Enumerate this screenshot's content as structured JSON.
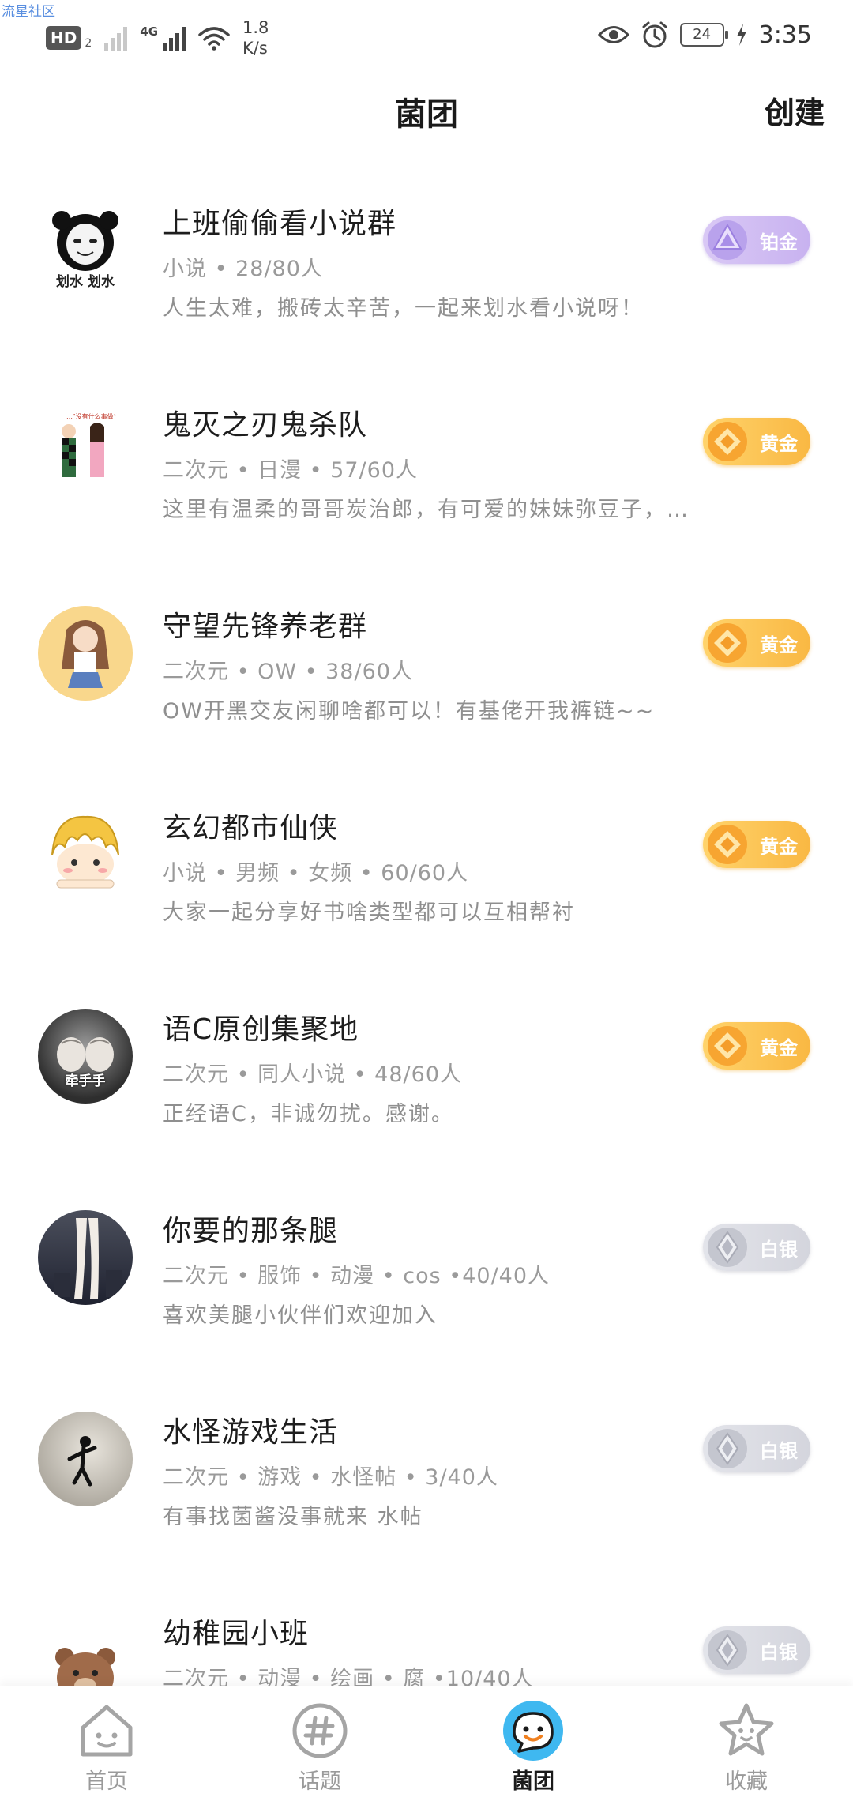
{
  "watermark": "流星社区",
  "status_bar": {
    "hd_label": "HD",
    "hd_sub": "2",
    "network_type": "4G",
    "speed_value": "1.8",
    "speed_unit": "K/s",
    "battery": "24",
    "time": "3:35"
  },
  "header": {
    "title": "菌团",
    "create_label": "创建"
  },
  "groups": [
    {
      "name": "上班偷偷看小说群",
      "meta": "小说 • 28/80人",
      "desc": "人生太难，搬砖太辛苦，一起来划水看小说呀！",
      "badge": "铂金",
      "tier": "platinum",
      "avatar_caption": "划水 划水"
    },
    {
      "name": "鬼灭之刃鬼杀队",
      "meta": "二次元 • 日漫 • 57/60人",
      "desc": "这里有温柔的哥哥炭治郎，有可爱的妹妹弥豆子，…",
      "badge": "黄金",
      "tier": "gold",
      "avatar_caption": ""
    },
    {
      "name": "守望先锋养老群",
      "meta": "二次元 • OW • 38/60人",
      "desc": "OW开黑交友闲聊啥都可以！有基佬开我裤链~~",
      "badge": "黄金",
      "tier": "gold",
      "avatar_caption": ""
    },
    {
      "name": "玄幻都市仙侠",
      "meta": "小说 • 男频 • 女频 • 60/60人",
      "desc": "大家一起分享好书啥类型都可以互相帮衬",
      "badge": "黄金",
      "tier": "gold",
      "avatar_caption": ""
    },
    {
      "name": "语C原创集聚地",
      "meta": "二次元 • 同人小说 • 48/60人",
      "desc": "正经语C，非诚勿扰。感谢。",
      "badge": "黄金",
      "tier": "gold",
      "avatar_caption": "牵手手"
    },
    {
      "name": "你要的那条腿",
      "meta": "二次元 • 服饰 • 动漫 • cos •40/40人",
      "desc": "喜欢美腿小伙伴们欢迎加入",
      "badge": "白银",
      "tier": "silver",
      "avatar_caption": ""
    },
    {
      "name": "水怪游戏生活",
      "meta": "二次元 • 游戏 • 水怪帖 • 3/40人",
      "desc": "有事找菌酱没事就来 水帖",
      "badge": "白银",
      "tier": "silver",
      "avatar_caption": ""
    },
    {
      "name": "幼稚园小班",
      "meta": "二次元 • 动漫 • 绘画 • 腐 •10/40人",
      "desc": "",
      "badge": "白银",
      "tier": "silver",
      "avatar_caption": ""
    }
  ],
  "nav": [
    {
      "label": "首页",
      "icon": "home-icon"
    },
    {
      "label": "话题",
      "icon": "hashtag-icon"
    },
    {
      "label": "菌团",
      "icon": "smiley-icon"
    },
    {
      "label": "收藏",
      "icon": "star-icon"
    }
  ],
  "colors": {
    "platinum": "#c8b2f0",
    "gold": "#f9b843",
    "silver": "#d4d5dd",
    "active_nav": "#3fb8f0"
  }
}
